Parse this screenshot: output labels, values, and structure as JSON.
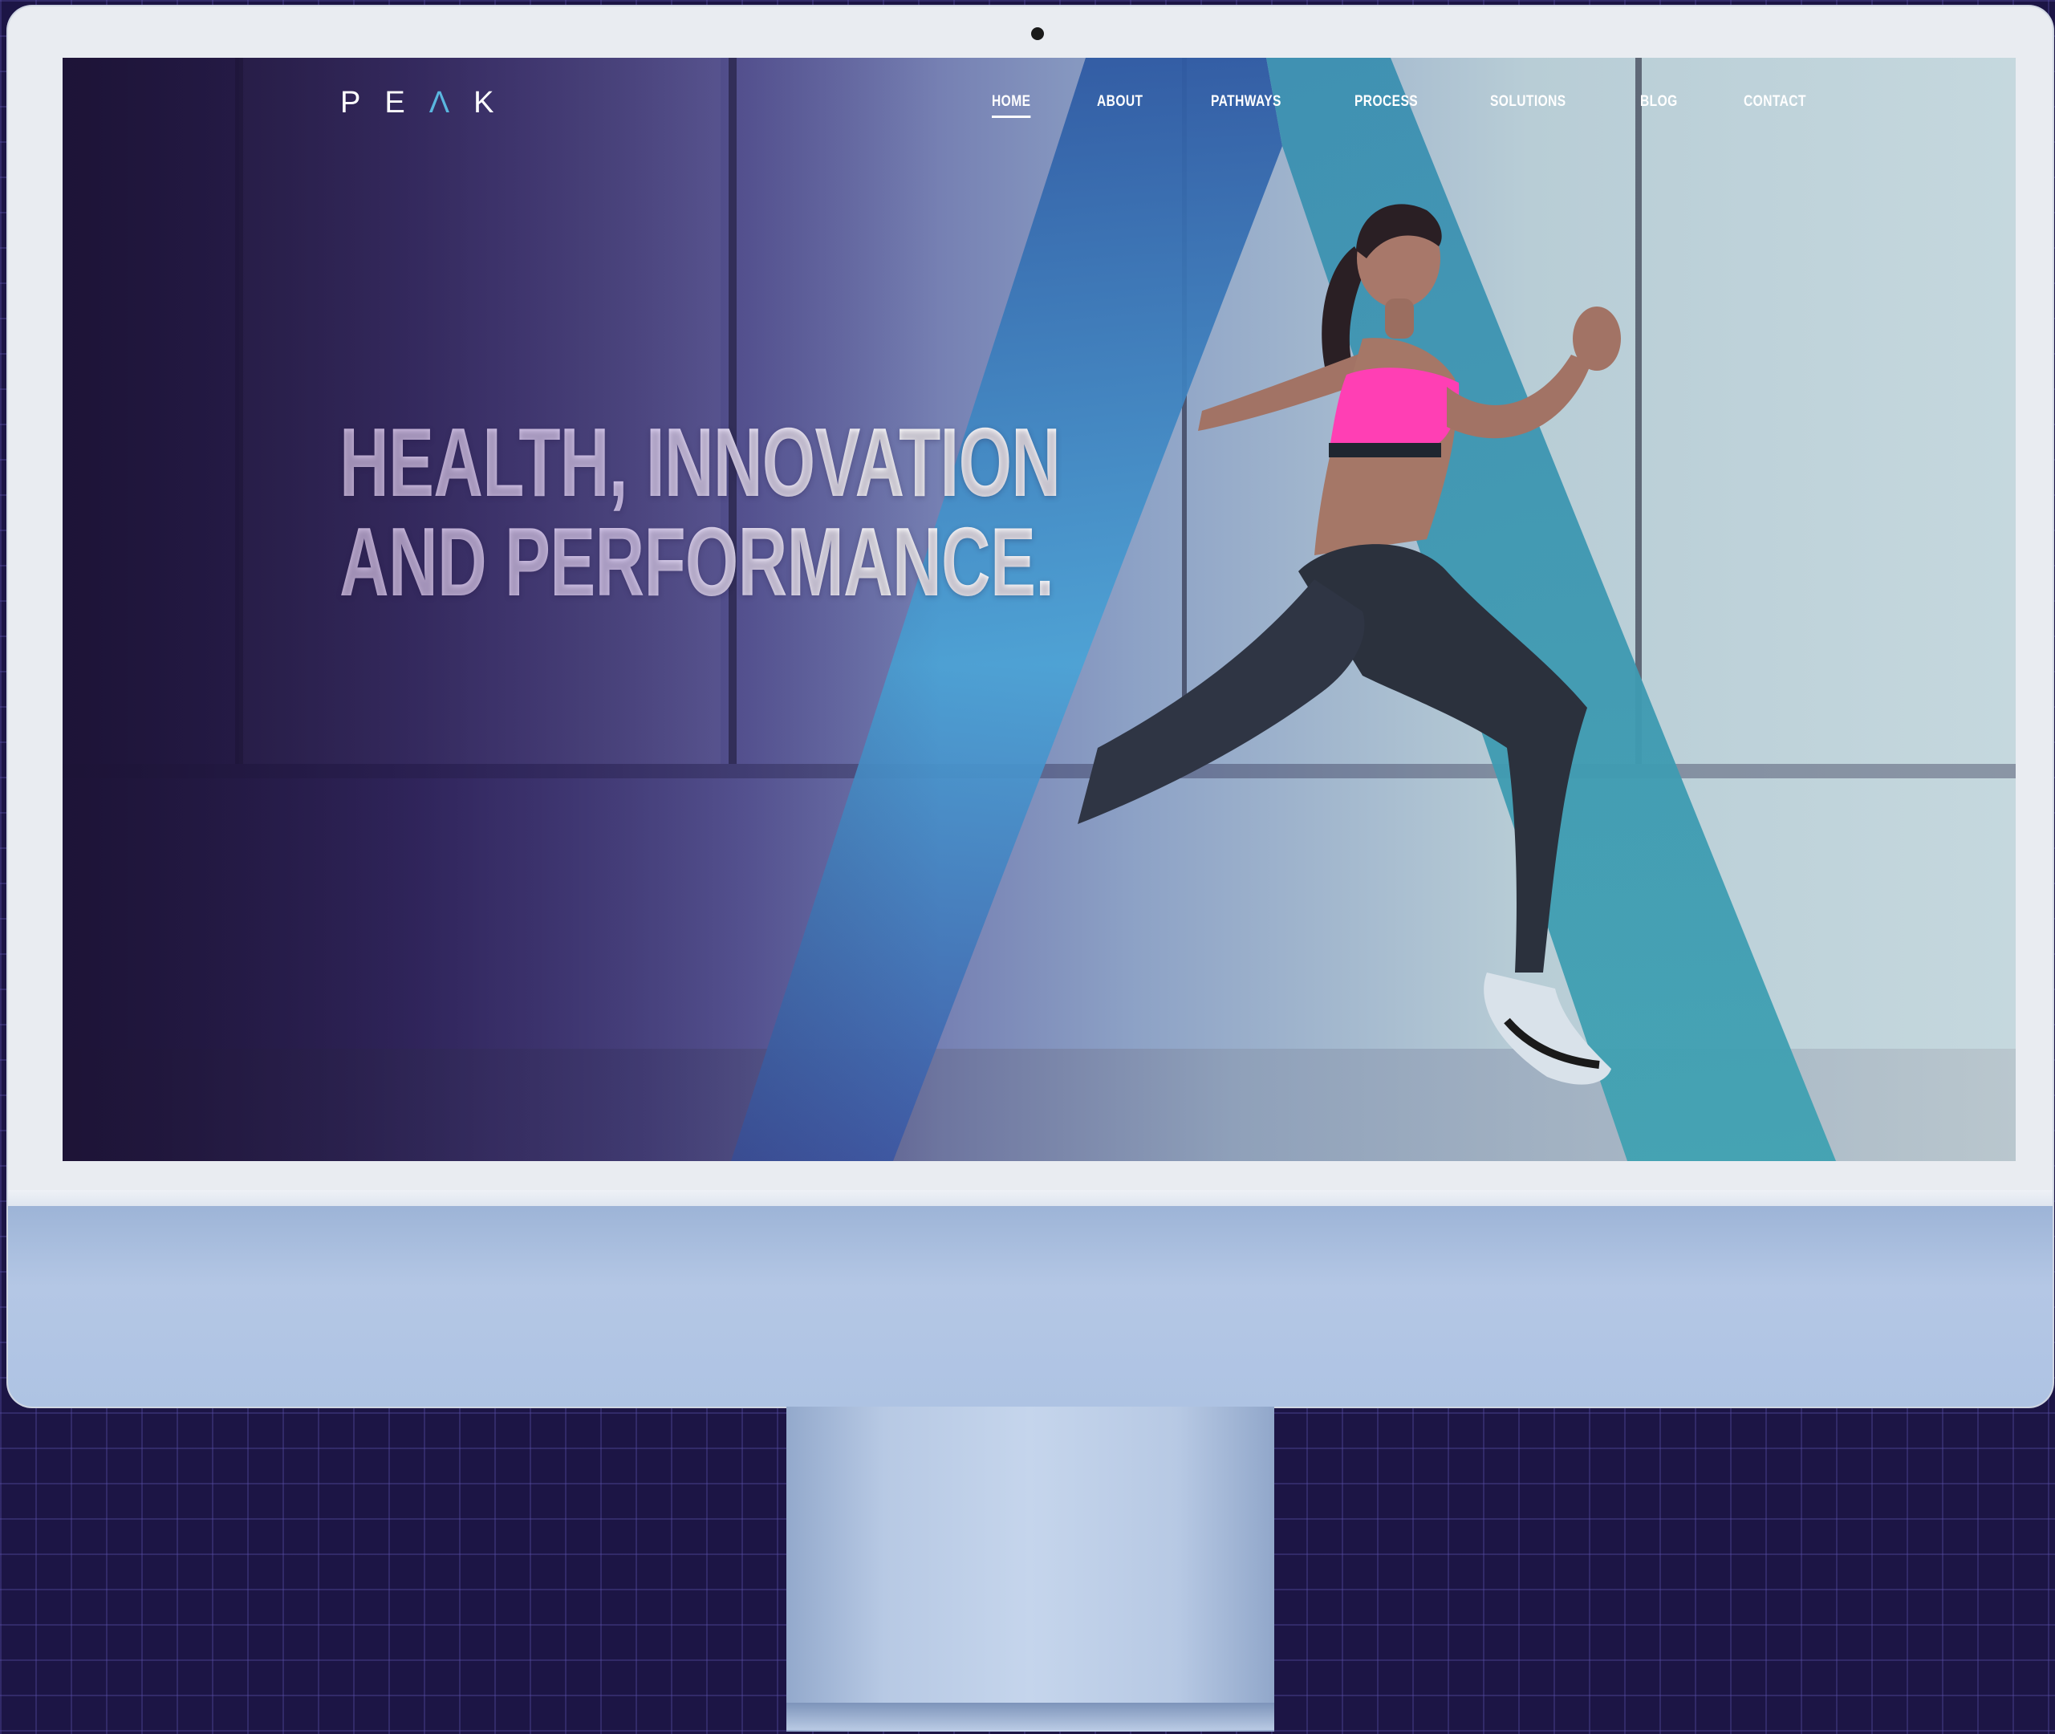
{
  "site": {
    "logo": {
      "letter_1": "P",
      "letter_2": "E",
      "letter_accent": "Λ",
      "letter_4": "K",
      "accent_color": "#5ab6df"
    },
    "nav": {
      "items": [
        {
          "label": "HOME",
          "active": true
        },
        {
          "label": "ABOUT",
          "active": false
        },
        {
          "label": "PATHWAYS",
          "active": false
        },
        {
          "label": "PROCESS",
          "active": false
        },
        {
          "label": "SOLUTIONS",
          "active": false
        },
        {
          "label": "BLOG",
          "active": false
        },
        {
          "label": "CONTACT",
          "active": false
        }
      ]
    },
    "hero": {
      "headline_line_1": "HEALTH, INNOVATION",
      "headline_line_2": "AND PERFORMANCE."
    }
  },
  "colors": {
    "background": "#1c1545",
    "monitor_bezel": "#e9ecf1",
    "monitor_chin": "#aec3e3",
    "a_shape_left": "#3f67b0",
    "a_shape_right": "#3f9fb0",
    "top_color": "#ff3fb4"
  },
  "icons": {
    "camera": "camera-icon",
    "hero_image": "runner-image",
    "a_graphic": "peak-a-graphic"
  }
}
